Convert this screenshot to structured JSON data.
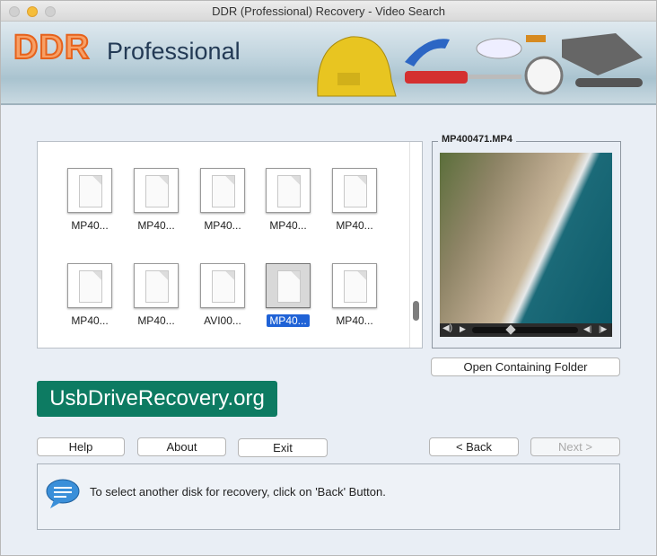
{
  "window": {
    "title": "DDR (Professional) Recovery - Video Search"
  },
  "banner": {
    "brand": "DDR",
    "product": "Professional"
  },
  "files": [
    {
      "label": "MP40...",
      "selected": false
    },
    {
      "label": "MP40...",
      "selected": false
    },
    {
      "label": "MP40...",
      "selected": false
    },
    {
      "label": "MP40...",
      "selected": false
    },
    {
      "label": "MP40...",
      "selected": false
    },
    {
      "label": "MP40...",
      "selected": false
    },
    {
      "label": "MP40...",
      "selected": false
    },
    {
      "label": "AVI00...",
      "selected": false
    },
    {
      "label": "MP40...",
      "selected": true
    },
    {
      "label": "MP40...",
      "selected": false
    }
  ],
  "preview": {
    "filename": "MP400471.MP4",
    "open_folder": "Open Containing Folder",
    "seek_position": 0.35
  },
  "site_logo": "UsbDriveRecovery.org",
  "buttons": {
    "help": "Help",
    "about": "About",
    "exit": "Exit",
    "back": "< Back",
    "next": "Next >"
  },
  "message": "To select another disk for recovery, click on 'Back' Button."
}
